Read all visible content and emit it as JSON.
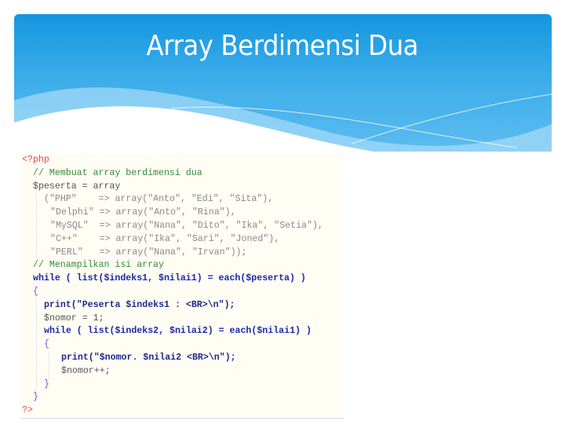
{
  "slide": {
    "title": "Array Berdimensi Dua",
    "colors": {
      "header_top": "#1496e0",
      "header_bottom": "#5cbcf0",
      "code_background": "#fffdf4",
      "keyword": "#1a2aa8",
      "comment": "#3a8a3a",
      "php_tag": "#e8454d",
      "string": "#8a8a8a"
    }
  },
  "code": {
    "language": "php",
    "lines": [
      "<?php",
      "// Membuat array berdimensi dua",
      "$peserta = array",
      "(\"PHP\"    => array(\"Anto\", \"Edi\", \"Sita\"),",
      "\"Delphi\" => array(\"Anto\", \"Rina\"),",
      "\"MySQL\"  => array(\"Nana\", \"Dito\", \"Ika\", \"Setia\"),",
      "\"C++\"    => array(\"Ika\", \"Sari\", \"Joned\"),",
      "\"PERL\"   => array(\"Nana\", \"Irvan\"));",
      "// Menampilkan isi array",
      "while ( list($indeks1, $nilai1) = each($peserta) )",
      "{",
      "print(\"Peserta $indeks1 : <BR>\\n\");",
      "$nomor = 1;",
      "while ( list($indeks2, $nilai2) = each($nilai1) )",
      "{",
      "print(\"$nomor. $nilai2 <BR>\\n\");",
      "$nomor++;",
      "}",
      "}",
      "?>"
    ]
  }
}
